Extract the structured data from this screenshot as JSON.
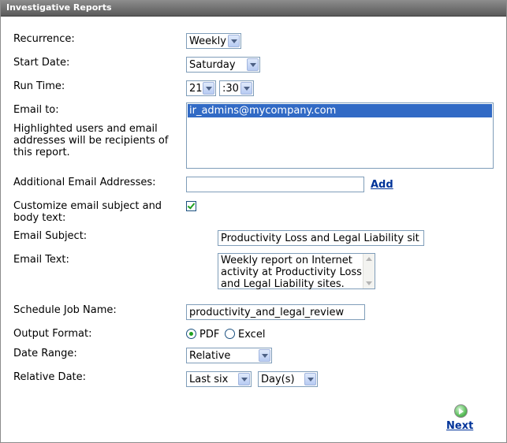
{
  "panel": {
    "title": "Investigative Reports"
  },
  "form": {
    "recurrence": {
      "label": "Recurrence:",
      "value": "Weekly"
    },
    "start_date": {
      "label": "Start Date:",
      "value": "Saturday"
    },
    "run_time": {
      "label": "Run Time:",
      "hour": "21",
      "minute": ":30"
    },
    "email_to": {
      "label": "Email to:",
      "help": "Highlighted users and email addresses will be recipients of this report.",
      "recipients": [
        "ir_admins@mycompany.com"
      ]
    },
    "additional_emails": {
      "label": "Additional Email Addresses:",
      "value": "",
      "add_label": "Add"
    },
    "customize": {
      "label": "Customize email subject and body text:",
      "checked": true
    },
    "email_subject": {
      "label": "Email Subject:",
      "value": "Productivity Loss and Legal Liability sit"
    },
    "email_text": {
      "label": "Email Text:",
      "value": "Weekly report on Internet activity at Productivity Loss and Legal Liability sites."
    },
    "job_name": {
      "label": "Schedule Job Name:",
      "value": "productivity_and_legal_review"
    },
    "output_format": {
      "label": "Output Format:",
      "options": [
        "PDF",
        "Excel"
      ],
      "selected": "PDF"
    },
    "date_range": {
      "label": "Date Range:",
      "value": "Relative"
    },
    "relative_date": {
      "label": "Relative Date:",
      "amount": "Last six",
      "unit": "Day(s)"
    }
  },
  "actions": {
    "next_label": "Next"
  }
}
